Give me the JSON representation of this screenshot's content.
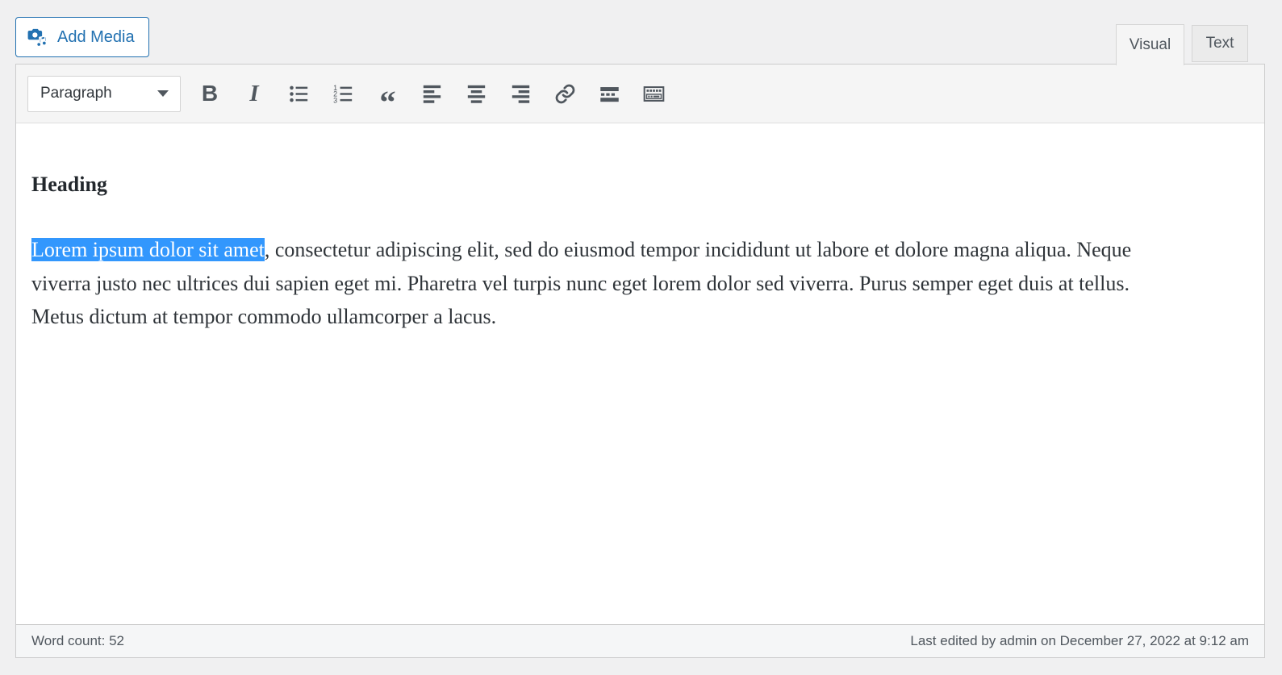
{
  "media_button": {
    "label": "Add Media",
    "icon": "media-camera-note-icon"
  },
  "tabs": {
    "visual": {
      "label": "Visual",
      "active": true
    },
    "text": {
      "label": "Text",
      "active": false
    }
  },
  "toolbar": {
    "format_select_value": "Paragraph",
    "glyphs": {
      "bold": "B",
      "italic": "I"
    },
    "buttons": [
      "bold",
      "italic",
      "bulleted-list",
      "numbered-list",
      "blockquote",
      "align-left",
      "align-center",
      "align-right",
      "insert-link",
      "insert-read-more",
      "toolbar-toggle"
    ]
  },
  "editor": {
    "heading": "Heading",
    "selected_text": "Lorem ipsum dolor sit amet",
    "paragraph_rest": ", consectetur adipiscing elit, sed do eiusmod tempor incididunt ut labore et dolore magna aliqua. Neque viverra justo nec ultrices dui sapien eget mi. Pharetra vel turpis nunc eget lorem dolor sed viverra. Purus semper eget duis at tellus. Metus dictum at tempor commodo ullamcorper a lacus."
  },
  "statusbar": {
    "word_count": "Word count: 52",
    "last_edited": "Last edited by admin on December 27, 2022 at 9:12 am"
  },
  "colors": {
    "accent": "#2271b1",
    "selection_bg": "#3297fd",
    "selection_text": "#ffffff",
    "toolbar_bg": "#f5f5f5",
    "page_bg": "#f0f0f1",
    "border": "#cccccc",
    "icon": "#50575e"
  }
}
